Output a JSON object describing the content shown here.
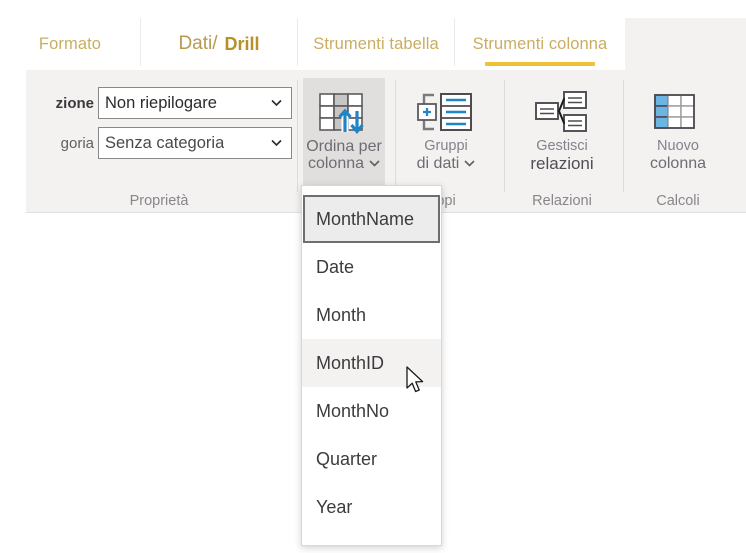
{
  "ribbon": {
    "tabs": [
      {
        "name": "formato",
        "label": "Formato"
      },
      {
        "name": "dati-drill",
        "label_part1": "Dati/",
        "label_part2": "Drill"
      },
      {
        "name": "strumenti-tabella",
        "label": "Strumenti tabella"
      },
      {
        "name": "strumenti-colonna",
        "label": "Strumenti colonna",
        "active": true
      }
    ],
    "groups": {
      "proprieta": {
        "label": "Proprietà",
        "fields": [
          {
            "name": "riepilogazione",
            "label": "zione",
            "value": "Non riepilogare"
          },
          {
            "name": "categoria",
            "label": "goria",
            "value": "Senza categoria"
          }
        ]
      },
      "ordinamento": {
        "button": {
          "line1": "Ordina per",
          "line2": "colonna"
        }
      },
      "gruppi": {
        "label": "ppi",
        "button": {
          "line1": "Gruppi",
          "line2": "di dati"
        }
      },
      "relazioni": {
        "label": "Relazioni",
        "button": {
          "line1": "Gestisci",
          "line2": "relazioni"
        }
      },
      "calcoli": {
        "label": "Calcoli",
        "button": {
          "line1": "Nuovo",
          "line2": "colonna"
        }
      }
    }
  },
  "dropdown": {
    "name": "ordina-per-colonna-menu",
    "items": [
      {
        "label": "MonthName",
        "state": "selected"
      },
      {
        "label": "Date",
        "state": "normal"
      },
      {
        "label": "Month",
        "state": "normal"
      },
      {
        "label": "MonthID",
        "state": "hover"
      },
      {
        "label": "MonthNo",
        "state": "normal"
      },
      {
        "label": "Quarter",
        "state": "normal"
      },
      {
        "label": "Year",
        "state": "normal"
      }
    ]
  },
  "colors": {
    "tab_gold": "#c9ad63",
    "tab_active_underline": "#eec234",
    "ribbon_bg": "#f3f2f1",
    "icon_blue": "#1b7ac2"
  }
}
